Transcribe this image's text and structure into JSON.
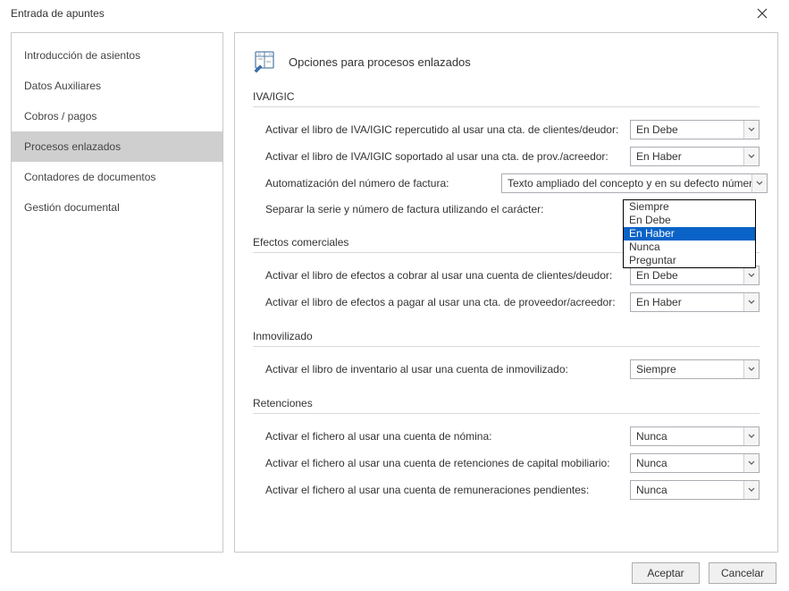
{
  "window": {
    "title": "Entrada de apuntes"
  },
  "sidebar": {
    "items": [
      {
        "label": "Introducción de asientos"
      },
      {
        "label": "Datos Auxiliares"
      },
      {
        "label": "Cobros / pagos"
      },
      {
        "label": "Procesos enlazados"
      },
      {
        "label": "Contadores de documentos"
      },
      {
        "label": "Gestión documental"
      }
    ],
    "active_index": 3
  },
  "page": {
    "title": "Opciones para procesos enlazados"
  },
  "sections": {
    "iva": {
      "title": "IVA/IGIC",
      "row1": {
        "label": "Activar el libro de IVA/IGIC repercutido al usar una cta. de clientes/deudor:",
        "value": "En Debe"
      },
      "row2": {
        "label": "Activar el libro de IVA/IGIC soportado al usar una cta. de prov./acreedor:",
        "value": "En Haber"
      },
      "row3": {
        "label": "Automatización del número de factura:",
        "value": "Texto ampliado del concepto y en su defecto número del documento"
      },
      "row4": {
        "label": "Separar la serie y número de factura utilizando el carácter:",
        "value": ""
      }
    },
    "efectos": {
      "title": "Efectos comerciales",
      "row1": {
        "label": "Activar el libro de efectos a cobrar al usar una cuenta de clientes/deudor:",
        "value": "En Debe"
      },
      "row2": {
        "label": "Activar el libro de efectos a pagar al usar una cta. de proveedor/acreedor:",
        "value": "En Haber"
      }
    },
    "inmov": {
      "title": "Inmovilizado",
      "row1": {
        "label": "Activar el libro de inventario al usar una cuenta de inmovilizado:",
        "value": "Siempre"
      }
    },
    "ret": {
      "title": "Retenciones",
      "row1": {
        "label": "Activar el fichero al usar una cuenta de nómina:",
        "value": "Nunca"
      },
      "row2": {
        "label": "Activar el fichero al usar una cuenta de retenciones de capital mobiliario:",
        "value": "Nunca"
      },
      "row3": {
        "label": "Activar el fichero al usar una cuenta de remuneraciones pendientes:",
        "value": "Nunca"
      }
    }
  },
  "dropdown_open": {
    "options": [
      "Siempre",
      "En Debe",
      "En Haber",
      "Nunca",
      "Preguntar"
    ],
    "selected_index": 2
  },
  "footer": {
    "ok": "Aceptar",
    "cancel": "Cancelar"
  }
}
